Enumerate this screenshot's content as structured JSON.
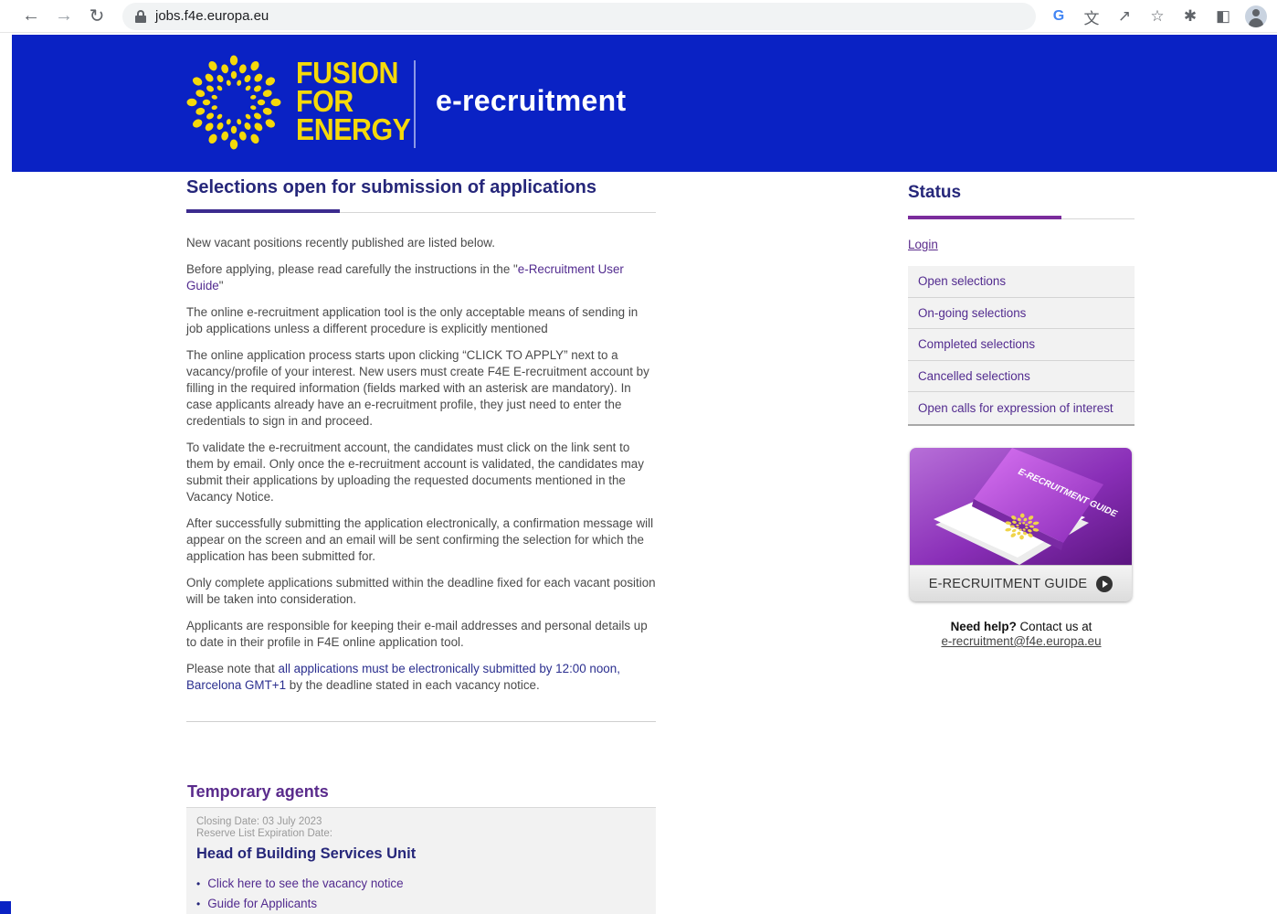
{
  "browser": {
    "url": "jobs.f4e.europa.eu",
    "icons": [
      "back-icon",
      "forward-icon",
      "reload-icon",
      "lock-icon",
      "google-icon",
      "translate-icon",
      "share-icon",
      "star-icon",
      "extensions-icon",
      "sidepanel-icon",
      "profile-icon"
    ]
  },
  "banner": {
    "logo_lines": [
      "FUSION",
      "FOR",
      "ENERGY"
    ],
    "title": "e-recruitment",
    "bg_color": "#0a22c4",
    "logo_color": "#f5d90a"
  },
  "main": {
    "title": "Selections open for submission of applications",
    "p1": "New vacant positions recently published are listed below.",
    "p2_before": "Before applying, please read carefully the instructions in the \"",
    "p2_link": "e-Recruitment User Guide",
    "p2_after": "\"",
    "p3": "The online e-recruitment application tool is the only acceptable means of sending in job applications unless a different procedure is explicitly mentioned",
    "p4": "The online application process starts upon clicking “CLICK TO APPLY” next to a vacancy/profile of your interest. New users must create F4E E-recruitment account by filling in the required information (fields marked with an asterisk are mandatory). In case applicants already have an e-recruitment profile, they just need to enter the credentials to sign in and proceed.",
    "p5": "To validate the e-recruitment account, the candidates must click on the link sent to them by email. Only once the e-recruitment account is validated, the candidates may submit their applications by uploading the requested documents mentioned in the Vacancy Notice.",
    "p6": "After successfully submitting the application electronically, a confirmation message will appear on the screen and an email will be sent confirming the selection for which the application has been submitted for.",
    "p7": "Only complete applications submitted within the deadline fixed for each vacant position will be taken into consideration.",
    "p8": "Applicants are responsible for keeping their e-mail addresses and personal details up to date in their profile in F4E online application tool.",
    "p9_before": "Please note that ",
    "p9_highlight": "all applications must be electronically submitted by 12:00 noon, Barcelona GMT+1",
    "p9_after": " by the deadline stated in each vacancy notice."
  },
  "section": {
    "title": "Temporary agents",
    "vacancy": {
      "closing": "Closing Date: 03 July 2023",
      "reserve": "Reserve List Expiration Date:",
      "title": "Head of Building Services Unit",
      "links": [
        "Click here to see the vacancy notice",
        "Guide for Applicants"
      ]
    }
  },
  "sidebar": {
    "title": "Status",
    "login": "Login",
    "menu": [
      "Open selections",
      "On-going selections",
      "Completed selections",
      "Cancelled selections",
      "Open calls for expression of interest"
    ],
    "guide_book_text": "E-RECRUITMENT GUIDE",
    "guide_label": "E-RECRUITMENT GUIDE",
    "help_strong": "Need help?",
    "help_text": " Contact us at",
    "help_email": "e-recruitment@f4e.europa.eu"
  }
}
